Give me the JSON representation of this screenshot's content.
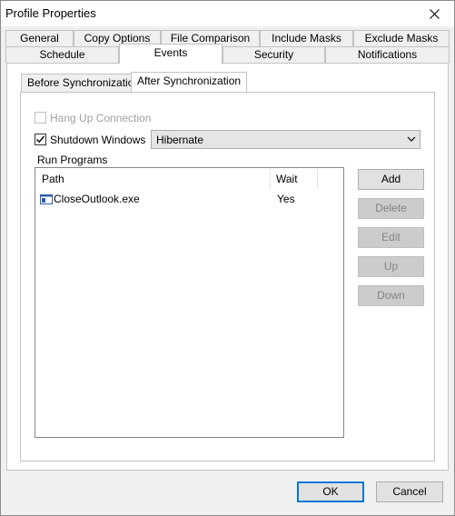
{
  "window": {
    "title": "Profile Properties"
  },
  "tabs_top_row": [
    {
      "label": "General"
    },
    {
      "label": "Copy Options"
    },
    {
      "label": "File Comparison"
    },
    {
      "label": "Include Masks"
    },
    {
      "label": "Exclude Masks"
    }
  ],
  "tabs_bottom_row": [
    {
      "label": "Schedule"
    },
    {
      "label": "Events",
      "selected": true
    },
    {
      "label": "Security"
    },
    {
      "label": "Notifications"
    }
  ],
  "event_tabs": [
    {
      "label": "Before Synchronization"
    },
    {
      "label": "After Synchronization",
      "selected": true
    }
  ],
  "options": {
    "hang_up": {
      "label": "Hang Up Connection",
      "checked": false,
      "enabled": false
    },
    "shutdown": {
      "label": "Shutdown Windows",
      "checked": true,
      "enabled": true
    },
    "shutdown_mode": {
      "value": "Hibernate"
    }
  },
  "run_programs": {
    "label": "Run Programs",
    "columns": [
      "Path",
      "Wait"
    ],
    "rows": [
      {
        "path": "CloseOutlook.exe",
        "wait": "Yes",
        "icon": "program-window-icon"
      }
    ]
  },
  "side_buttons": {
    "add": "Add",
    "delete": "Delete",
    "edit": "Edit",
    "up": "Up",
    "down": "Down"
  },
  "dialog_buttons": {
    "ok": "OK",
    "cancel": "Cancel"
  },
  "colors": {
    "accent": "#0078d7",
    "disabled_text": "#a0a0a0",
    "panel_bg": "#ffffff",
    "window_bg": "#f0f0f0"
  }
}
